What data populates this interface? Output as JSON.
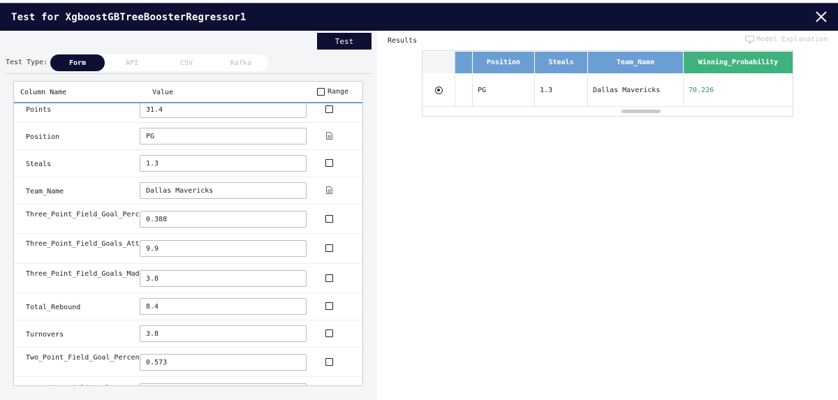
{
  "dialog": {
    "title": "Test for XgboostGBTreeBoosterRegressor1"
  },
  "left": {
    "test_button": "Test",
    "test_type_label": "Test Type:",
    "test_types": [
      "Form",
      "API",
      "CSV",
      "Kafka"
    ],
    "active_test_type": "Form",
    "form": {
      "headers": {
        "column_name": "Column Name",
        "value": "Value",
        "range": "Range"
      },
      "rows": [
        {
          "name": "Points",
          "value": "31.4",
          "control": "checkbox"
        },
        {
          "name": "Position",
          "value": "PG",
          "control": "doc"
        },
        {
          "name": "Steals",
          "value": "1.3",
          "control": "checkbox"
        },
        {
          "name": "Team_Name",
          "value": "Dallas Mavericks",
          "control": "doc"
        },
        {
          "name": "Three_Point_Field_Goal_Percentage",
          "value": "0.388",
          "control": "checkbox"
        },
        {
          "name": "Three_Point_Field_Goals_Attempted",
          "value": "9.9",
          "control": "checkbox"
        },
        {
          "name": "Three_Point_Field_Goals_Made",
          "value": "3.8",
          "control": "checkbox"
        },
        {
          "name": "Total_Rebound",
          "value": "8.4",
          "control": "checkbox"
        },
        {
          "name": "Turnovers",
          "value": "3.8",
          "control": "checkbox"
        },
        {
          "name": "Two_Point_Field_Goal_Percentage",
          "value": "0.573",
          "control": "checkbox"
        },
        {
          "name": "Two_Point_Field_Goals_Att",
          "value": "",
          "control": "checkbox"
        }
      ]
    }
  },
  "right": {
    "results_label": "Results",
    "model_explanation": "Model Explanation",
    "table": {
      "headers": [
        "Position",
        "Steals",
        "Team_Name",
        "Winning_Probability"
      ],
      "row": {
        "Position": "PG",
        "Steals": "1.3",
        "Team_Name": "Dallas Mavericks",
        "Winning_Probability": "70.226"
      }
    }
  },
  "colors": {
    "header_blue": "#6b9fd4",
    "winning_green": "#3fb27f",
    "title_bar": "#0d0f33",
    "prob_text": "#2c8f5e"
  }
}
